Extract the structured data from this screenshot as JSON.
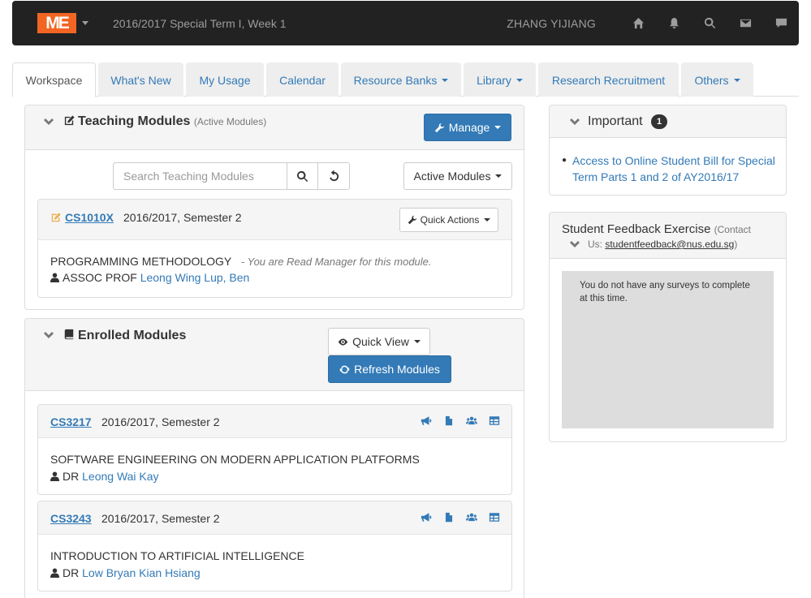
{
  "navbar": {
    "brand": "ME",
    "term": "2016/2017 Special Term I, Week 1",
    "username": "ZHANG YIJIANG",
    "icons": [
      "home-icon",
      "bell-icon",
      "search-icon",
      "envelope-icon",
      "comment-icon"
    ]
  },
  "tabs": [
    {
      "label": "Workspace",
      "active": true
    },
    {
      "label": "What's New"
    },
    {
      "label": "My Usage"
    },
    {
      "label": "Calendar"
    },
    {
      "label": "Resource Banks",
      "dropdown": true
    },
    {
      "label": "Library",
      "dropdown": true
    },
    {
      "label": "Research Recruitment"
    },
    {
      "label": "Others",
      "dropdown": true
    }
  ],
  "teaching": {
    "title": "Teaching Modules",
    "subtitle": "(Active Modules)",
    "manage_label": "Manage",
    "search_placeholder": "Search Teaching Modules",
    "filter_label": "Active Modules",
    "module": {
      "code": "CS1010X",
      "semester": "2016/2017, Semester 2",
      "quick_actions": "Quick Actions",
      "title": "PROGRAMMING METHODOLOGY",
      "note": "- You are Read Manager for this module.",
      "staff_prefix": "ASSOC PROF",
      "staff_name": "Leong Wing Lup, Ben"
    }
  },
  "enrolled": {
    "title": "Enrolled Modules",
    "quick_view": "Quick View",
    "refresh": "Refresh Modules",
    "modules": [
      {
        "code": "CS3217",
        "semester": "2016/2017, Semester 2",
        "title": "SOFTWARE ENGINEERING ON MODERN APPLICATION PLATFORMS",
        "staff_prefix": "DR",
        "staff_name": "Leong Wai Kay"
      },
      {
        "code": "CS3243",
        "semester": "2016/2017, Semester 2",
        "title": "INTRODUCTION TO ARTIFICIAL INTELLIGENCE",
        "staff_prefix": "DR",
        "staff_name": "Low Bryan Kian Hsiang"
      }
    ]
  },
  "important": {
    "title": "Important",
    "count": "1",
    "link": "Access to Online Student Bill for Special Term Parts 1 and 2 of AY2016/17"
  },
  "feedback": {
    "title": "Student Feedback Exercise",
    "contact_prefix": "(Contact",
    "contact_us": "Us:",
    "email": "studentfeedback@nus.edu.sg",
    "contact_suffix": ")",
    "message": "You do not have any surveys to complete at this time."
  },
  "colors": {
    "brand": "#f26522",
    "navbar": "#222222",
    "primary": "#337ab7"
  }
}
